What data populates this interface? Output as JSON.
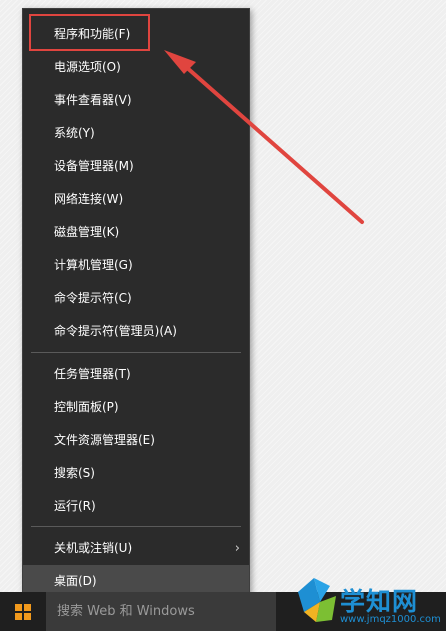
{
  "menu": {
    "items": [
      {
        "label": "程序和功能(F)"
      },
      {
        "label": "电源选项(O)"
      },
      {
        "label": "事件查看器(V)"
      },
      {
        "label": "系统(Y)"
      },
      {
        "label": "设备管理器(M)"
      },
      {
        "label": "网络连接(W)"
      },
      {
        "label": "磁盘管理(K)"
      },
      {
        "label": "计算机管理(G)"
      },
      {
        "label": "命令提示符(C)"
      },
      {
        "label": "命令提示符(管理员)(A)"
      },
      {
        "label": "任务管理器(T)"
      },
      {
        "label": "控制面板(P)"
      },
      {
        "label": "文件资源管理器(E)"
      },
      {
        "label": "搜索(S)"
      },
      {
        "label": "运行(R)"
      },
      {
        "label": "关机或注销(U)",
        "submenu_glyph": "›"
      },
      {
        "label": "桌面(D)"
      }
    ]
  },
  "taskbar": {
    "search_text": "搜索 Web 和 Windows"
  },
  "watermark": {
    "title": "学知网",
    "url": "www.jmqz1000.com"
  },
  "colors": {
    "menu_bg": "#2b2b2b",
    "highlight_bg": "#4a4a4a",
    "annotation_red": "#e0453f",
    "watermark_blue": "#1e8fd3"
  }
}
